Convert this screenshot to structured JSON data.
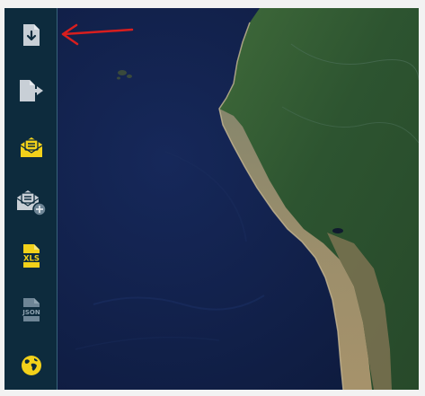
{
  "toolbar": {
    "items": [
      {
        "id": "download",
        "icon": "file-download-icon",
        "color": "#c8cfd6",
        "enabled": true
      },
      {
        "id": "export",
        "icon": "file-export-icon",
        "color": "#c8cfd6",
        "enabled": true
      },
      {
        "id": "mail-envelope",
        "icon": "envelope-open-text-icon",
        "color": "#f2d11a",
        "enabled": true
      },
      {
        "id": "mail-add",
        "icon": "envelope-add-icon",
        "color": "#c8cfd6",
        "enabled": true
      },
      {
        "id": "xls",
        "icon": "file-xls-icon",
        "label": "XLS",
        "color": "#f2d11a",
        "enabled": true
      },
      {
        "id": "json",
        "icon": "file-json-icon",
        "label": "JSON",
        "color": "#6e8596",
        "enabled": false
      },
      {
        "id": "globe",
        "icon": "globe-icon",
        "color": "#f2d11a",
        "enabled": true
      }
    ]
  },
  "annotation": {
    "arrow_color": "#d81e1e",
    "points_to": "download"
  },
  "map": {
    "ocean_color": "#13234f",
    "land_color": "#2f5a32",
    "coast_color": "#b9a98a"
  }
}
